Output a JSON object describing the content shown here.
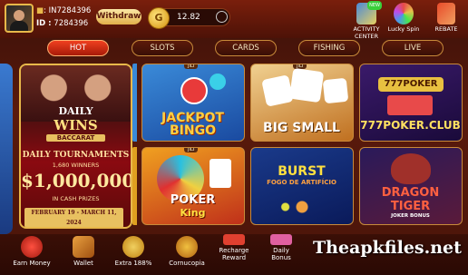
{
  "header": {
    "user_id_top": ": IN7284396",
    "id_label": "ID :",
    "id_value": "7284396",
    "withdraw_label": "Withdraw",
    "balance": "12.82"
  },
  "top_icons": {
    "activity": "ACTIVITY CENTER",
    "lucky_spin": "Lucky Spin",
    "rebate": "REBATE",
    "new_badge": "NEW"
  },
  "tabs": [
    "HOT",
    "SLOTS",
    "CARDS",
    "FISHING",
    "LIVE"
  ],
  "promo": {
    "title_top": "DAILY",
    "title_main": "WINS",
    "game": "BACCARAT",
    "tournaments": "DAILY TOURNAMENTS",
    "winners": "1,680 WINNERS",
    "prize": "$1,000,000",
    "prize_note": "IN CASH PRIZES",
    "dates": "FEBRUARY 19 - MARCH 11, 2024"
  },
  "games": {
    "jili_tag": "JILI",
    "g1_line1": "JACKPOT",
    "g1_line2": "BINGO",
    "g2": "BIG SMALL",
    "g3_top": "777POKER",
    "g3": "777POKER.CLUB",
    "g4_line1": "POKER",
    "g4_line2": "King",
    "g5_line1": "BURST",
    "g5_line2": "FOGO DE ARTIFÍCIO",
    "g6_line1": "DRAGON",
    "g6_line2": "TIGER",
    "g6_sub": "JOKER BONUS"
  },
  "bottom_nav": {
    "earn": "Earn Money",
    "wallet": "Wallet",
    "extra": "Extra 188%",
    "cornucopia": "Cornucopia",
    "recharge_line1": "Recharge",
    "recharge_line2": "Reward",
    "daily_line1": "Daily",
    "daily_line2": "Bonus"
  },
  "watermark": "Theapkfiles.net",
  "colors": {
    "accent_gold": "#e8b84a",
    "tab_active": "#e83418",
    "background": "#4a1409"
  }
}
